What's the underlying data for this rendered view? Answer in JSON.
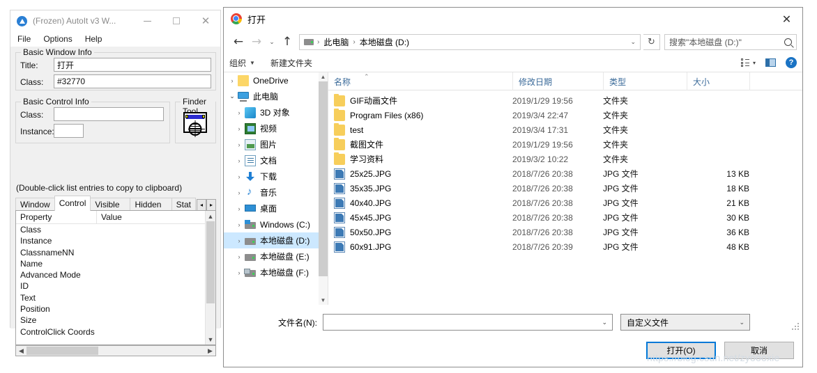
{
  "autoit": {
    "title": "(Frozen) AutoIt v3 W...",
    "icon": "autoit-logo-icon",
    "window_buttons": {
      "minimize": "minimize-icon",
      "maximize": "maximize-icon",
      "close": "close-icon"
    },
    "menu": [
      "File",
      "Options",
      "Help"
    ],
    "basic_window_info": {
      "legend": "Basic Window Info",
      "title_label": "Title:",
      "title_value": "打开",
      "class_label": "Class:",
      "class_value": "#32770"
    },
    "basic_control_info": {
      "legend": "Basic Control Info",
      "class_label": "Class:",
      "class_value": "",
      "instance_label": "Instance:",
      "instance_value": ""
    },
    "finder_tool": {
      "legend": "Finder Tool",
      "icon": "finder-target-icon"
    },
    "note": "(Double-click list entries to copy to clipboard)",
    "tabs": [
      {
        "label": "Window",
        "active": false
      },
      {
        "label": "Control",
        "active": true
      },
      {
        "label": "Visible Text",
        "active": false
      },
      {
        "label": "Hidden Text",
        "active": false
      },
      {
        "label": "Stat",
        "active": false
      }
    ],
    "tab_scroll": {
      "left": "◂",
      "right": "▸"
    },
    "list_headers": [
      "Property",
      "Value"
    ],
    "list_rows": [
      "Class",
      "Instance",
      "ClassnameNN",
      "Name",
      "Advanced Mode",
      "ID",
      "Text",
      "Position",
      "Size",
      "ControlClick Coords"
    ]
  },
  "dialog": {
    "title": "打开",
    "title_icon": "chrome-icon",
    "close_label": "✕",
    "nav": {
      "back": "←",
      "forward": "→",
      "recent": "⌄",
      "up": "↑",
      "breadcrumb": [
        "此电脑",
        "本地磁盘 (D:)"
      ],
      "drive_icon": "drive-icon",
      "address_dropdown": "⌄",
      "refresh": "↻"
    },
    "search": {
      "placeholder": "搜索\"本地磁盘 (D:)\"",
      "icon": "search-icon"
    },
    "toolbar": {
      "organize": "组织",
      "new_folder": "新建文件夹",
      "view_icon": "view-layout-icon",
      "view_caret": "▾",
      "preview_pane_icon": "preview-pane-icon",
      "help_icon": "help-icon",
      "help_label": "?"
    },
    "tree": [
      {
        "label": "OneDrive",
        "icon": "onedrive-folder-icon",
        "expander": "›",
        "indent": 0,
        "selected": false
      },
      {
        "label": "此电脑",
        "icon": "this-pc-icon",
        "expander": "⌄",
        "indent": 0,
        "selected": false
      },
      {
        "label": "3D 对象",
        "icon": "3d-objects-icon",
        "expander": "›",
        "indent": 1,
        "selected": false
      },
      {
        "label": "视频",
        "icon": "videos-icon",
        "expander": "›",
        "indent": 1,
        "selected": false
      },
      {
        "label": "图片",
        "icon": "pictures-icon",
        "expander": "›",
        "indent": 1,
        "selected": false
      },
      {
        "label": "文档",
        "icon": "documents-icon",
        "expander": "›",
        "indent": 1,
        "selected": false
      },
      {
        "label": "下载",
        "icon": "downloads-icon",
        "expander": "›",
        "indent": 1,
        "selected": false
      },
      {
        "label": "音乐",
        "icon": "music-icon",
        "expander": "›",
        "indent": 1,
        "selected": false
      },
      {
        "label": "桌面",
        "icon": "desktop-icon",
        "expander": "›",
        "indent": 1,
        "selected": false
      },
      {
        "label": "Windows (C:)",
        "icon": "windows-drive-icon",
        "expander": "›",
        "indent": 1,
        "selected": false
      },
      {
        "label": "本地磁盘 (D:)",
        "icon": "drive-icon",
        "expander": "›",
        "indent": 1,
        "selected": true
      },
      {
        "label": "本地磁盘 (E:)",
        "icon": "drive-icon",
        "expander": "›",
        "indent": 1,
        "selected": false
      },
      {
        "label": "本地磁盘 (F:)",
        "icon": "network-drive-icon",
        "expander": "›",
        "indent": 1,
        "selected": false
      }
    ],
    "columns": [
      "名称",
      "修改日期",
      "类型",
      "大小"
    ],
    "sort_indicator": "⌃",
    "files": [
      {
        "name": "GIF动画文件",
        "date": "2019/1/29 19:56",
        "type": "文件夹",
        "size": "",
        "icon": "folder-icon"
      },
      {
        "name": "Program Files (x86)",
        "date": "2019/3/4 22:47",
        "type": "文件夹",
        "size": "",
        "icon": "folder-icon"
      },
      {
        "name": "test",
        "date": "2019/3/4 17:31",
        "type": "文件夹",
        "size": "",
        "icon": "folder-icon"
      },
      {
        "name": "截图文件",
        "date": "2019/1/29 19:56",
        "type": "文件夹",
        "size": "",
        "icon": "folder-icon"
      },
      {
        "name": "学习资料",
        "date": "2019/3/2 10:22",
        "type": "文件夹",
        "size": "",
        "icon": "folder-icon"
      },
      {
        "name": "25x25.JPG",
        "date": "2018/7/26 20:38",
        "type": "JPG 文件",
        "size": "13 KB",
        "icon": "jpg-file-icon"
      },
      {
        "name": "35x35.JPG",
        "date": "2018/7/26 20:38",
        "type": "JPG 文件",
        "size": "18 KB",
        "icon": "jpg-file-icon"
      },
      {
        "name": "40x40.JPG",
        "date": "2018/7/26 20:38",
        "type": "JPG 文件",
        "size": "21 KB",
        "icon": "jpg-file-icon"
      },
      {
        "name": "45x45.JPG",
        "date": "2018/7/26 20:38",
        "type": "JPG 文件",
        "size": "30 KB",
        "icon": "jpg-file-icon"
      },
      {
        "name": "50x50.JPG",
        "date": "2018/7/26 20:38",
        "type": "JPG 文件",
        "size": "36 KB",
        "icon": "jpg-file-icon"
      },
      {
        "name": "60x91.JPG",
        "date": "2018/7/26 20:39",
        "type": "JPG 文件",
        "size": "48 KB",
        "icon": "jpg-file-icon"
      }
    ],
    "footer": {
      "filename_label": "文件名(N):",
      "filename_value": "",
      "filename_dropdown": "⌄",
      "filter_value": "自定义文件",
      "filter_dropdown": "⌄",
      "open_button": "打开(O)",
      "cancel_button": "取消"
    }
  },
  "watermark": "https://blog.csdn.net/zyoooxie",
  "colors": {
    "accent": "#0078d7",
    "selection": "#cce8ff",
    "column_header_text": "#3a6a99",
    "folder": "#f7ce5b"
  }
}
